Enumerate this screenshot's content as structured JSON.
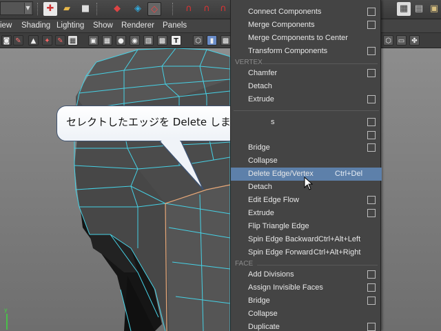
{
  "menubar": {
    "items": [
      "iew",
      "Shading",
      "Lighting",
      "Show",
      "Renderer",
      "Panels"
    ]
  },
  "callout": {
    "text": "セレクトしたエッジを Delete します。",
    "hidden_fragment": "s"
  },
  "menu": {
    "top_items": [
      {
        "label": "Connect Components",
        "has_option": true
      },
      {
        "label": "Merge Components",
        "has_option": true
      },
      {
        "label": "Merge Components to Center",
        "has_option": false
      },
      {
        "label": "Transform Components",
        "has_option": true
      }
    ],
    "vertex_section": "VERTEX",
    "vertex_items": [
      {
        "label": "Chamfer",
        "has_option": true
      },
      {
        "label": "Detach",
        "has_option": false
      },
      {
        "label": "Extrude",
        "has_option": true
      }
    ],
    "edge_items": [
      {
        "label": "Bridge",
        "has_option": true
      },
      {
        "label": "Collapse",
        "has_option": false
      },
      {
        "label": "Delete Edge/Vertex",
        "shortcut": "Ctrl+Del",
        "has_option": false,
        "highlighted": true
      },
      {
        "label": "Detach",
        "has_option": false
      },
      {
        "label": "Edit Edge Flow",
        "has_option": true
      },
      {
        "label": "Extrude",
        "has_option": true
      },
      {
        "label": "Flip Triangle Edge",
        "has_option": false
      },
      {
        "label": "Spin Edge Backward",
        "shortcut": "Ctrl+Alt+Left",
        "has_option": false
      },
      {
        "label": "Spin Edge Forward",
        "shortcut": "Ctrl+Alt+Right",
        "has_option": false
      }
    ],
    "face_section": "FACE",
    "face_items": [
      {
        "label": "Add Divisions",
        "has_option": true
      },
      {
        "label": "Assign Invisible Faces",
        "has_option": true
      },
      {
        "label": "Bridge",
        "has_option": true
      },
      {
        "label": "Collapse",
        "has_option": false
      },
      {
        "label": "Duplicate",
        "has_option": true
      }
    ]
  },
  "colors": {
    "highlight": "#5d80aa",
    "wire": "#46d2e6",
    "selected_edge": "#e8a878",
    "mesh_face": "#4a4a4a"
  }
}
